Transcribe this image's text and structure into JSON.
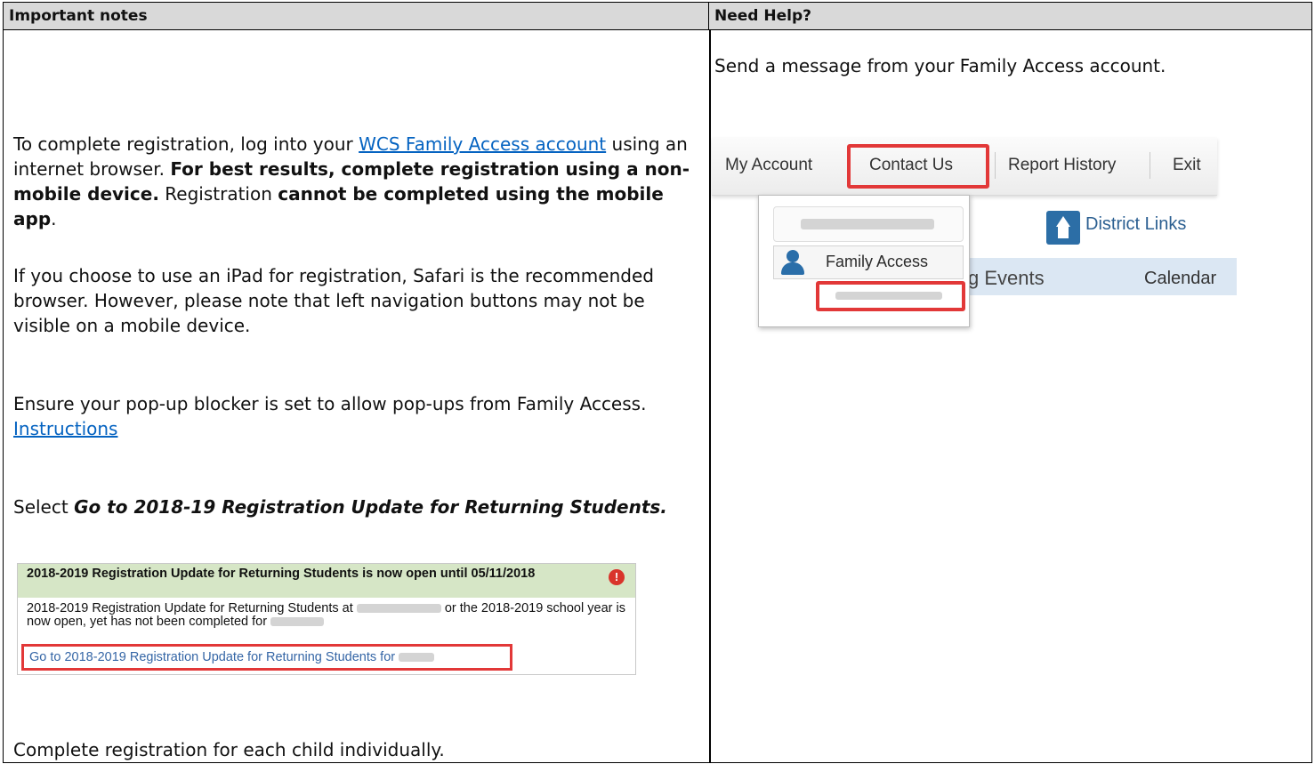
{
  "headers": {
    "left": "Important notes",
    "right": "Need Help?"
  },
  "left": {
    "p1": {
      "t1": "To complete registration, log into your ",
      "link": "WCS Family Access account",
      "t2": " using an internet browser.  ",
      "b1": "For best results, complete registration using a non-mobile device.",
      "t3": "  Registration ",
      "b2": "cannot be completed using the mobile app",
      "t4": "."
    },
    "p2": "If you choose to use an iPad for registration, Safari is the recommended browser. However, please note that left navigation buttons may not be visible on a mobile device.",
    "p3": {
      "t1": "Ensure your pop-up blocker is set to allow pop-ups from Family Access.  ",
      "link": "Instructions"
    },
    "p4": {
      "t1": "Select ",
      "bi": "Go to 2018-19 Registration Update for Returning Students."
    },
    "p5": "Complete registration for each child individually.",
    "screenshot": {
      "head": "2018-2019 Registration Update for Returning Students is now open until 05/11/2018",
      "alert": "!",
      "body1": "2018-2019 Registration Update for Returning Students at ",
      "body2": "or the 2018-2019 school year is now open, yet has not been completed for",
      "link": "Go to 2018-2019 Registration Update for Returning Students for"
    }
  },
  "right": {
    "p1": "Send a message from your Family Access account.",
    "screenshot": {
      "menu": [
        "My Account",
        "Contact Us",
        "Report History",
        "Exit"
      ],
      "family_access": "Family Access",
      "district_links": "District Links",
      "events": "g Events",
      "calendar": "Calendar"
    }
  }
}
